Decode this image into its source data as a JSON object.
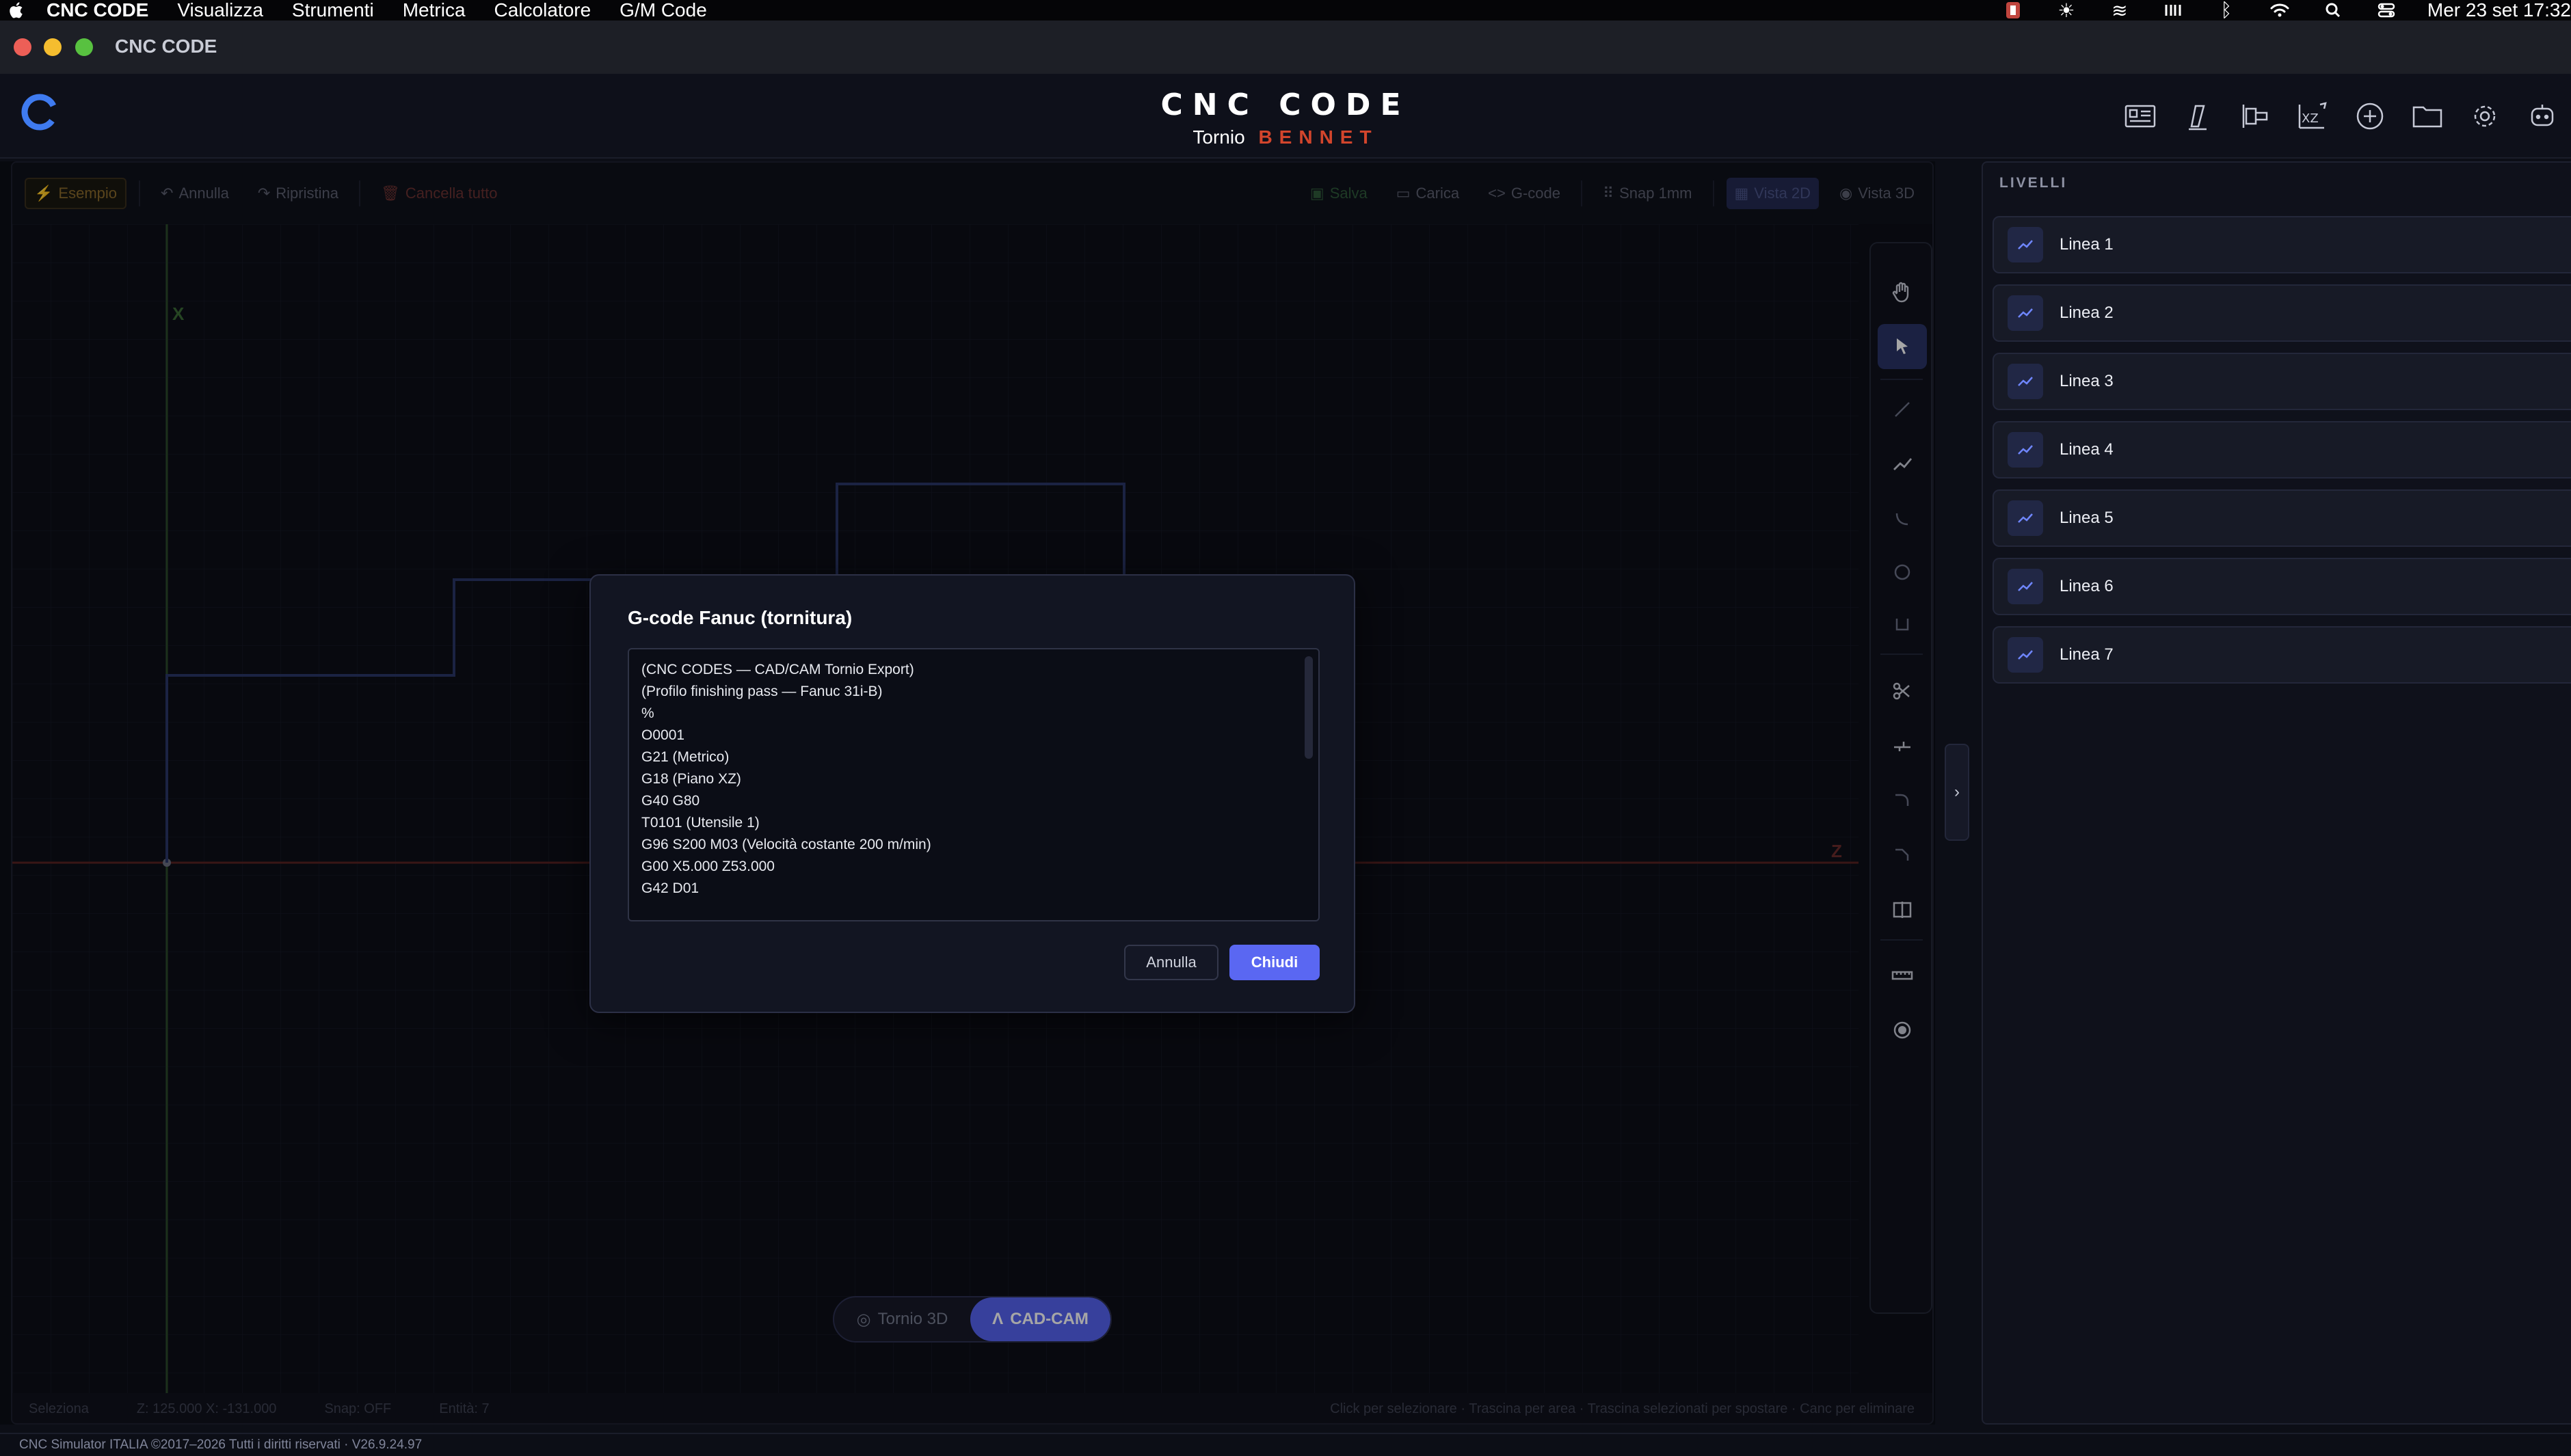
{
  "menubar": {
    "app": "CNC CODE",
    "items": [
      "Visualizza",
      "Strumenti",
      "Metrica",
      "Calcolatore",
      "G/M Code"
    ],
    "clock": "Mer 23 set  17:32"
  },
  "window": {
    "title": "CNC CODE"
  },
  "header": {
    "brand": "CNC CODE",
    "subtitle_left": "Tornio",
    "subtitle_right": "BENNET",
    "icons": [
      "machine-icon",
      "tool-icon",
      "stock-icon",
      "xz-icon",
      "add-icon",
      "folder-icon",
      "settings-icon",
      "assistant-icon"
    ]
  },
  "toolbar": {
    "example": "Esempio",
    "undo": "Annulla",
    "redo": "Ripristina",
    "clear": "Cancella tutto",
    "save": "Salva",
    "load": "Carica",
    "gcode": "G-code",
    "snap": "Snap 1mm",
    "view2d": "Vista 2D",
    "view3d": "Vista 3D"
  },
  "axes": {
    "x": "X",
    "z": "Z"
  },
  "mode_toggle": {
    "lathe3d": "Tornio 3D",
    "cadcam": "CAD-CAM",
    "active": "CAD-CAM"
  },
  "statusbar": {
    "mode": "Seleziona",
    "coords": "Z: 125.000 X: -131.000",
    "snap": "Snap: OFF",
    "entities": "Entità: 7",
    "hint": "Click per selezionare · Trascina per area · Trascina selezionati per spostare · Canc per eliminare"
  },
  "layers": {
    "title": "LIVELLI",
    "items": [
      "Linea 1",
      "Linea 2",
      "Linea 3",
      "Linea 4",
      "Linea 5",
      "Linea 6",
      "Linea 7"
    ]
  },
  "footer": {
    "text": "CNC Simulator ITALIA  ©2017–2026  Tutti i diritti riservati  ·  V26.9.24.97"
  },
  "modal": {
    "title": "G-code Fanuc (tornitura)",
    "code_lines": [
      "(CNC CODES — CAD/CAM Tornio Export)",
      "(Profilo finishing pass — Fanuc 31i-B)",
      "%",
      "O0001",
      "G21 (Metrico)",
      "G18 (Piano XZ)",
      "G40 G80",
      "T0101 (Utensile 1)",
      "G96 S200 M03 (Velocità costante 200 m/min)",
      "G00 X5.000 Z53.000",
      "G42 D01"
    ],
    "cancel": "Annulla",
    "close": "Chiudi"
  },
  "colors": {
    "accent": "#5a67f2",
    "brand_red": "#d2452c",
    "axis_x": "#4b9a3e",
    "axis_z": "#b83a3a"
  }
}
